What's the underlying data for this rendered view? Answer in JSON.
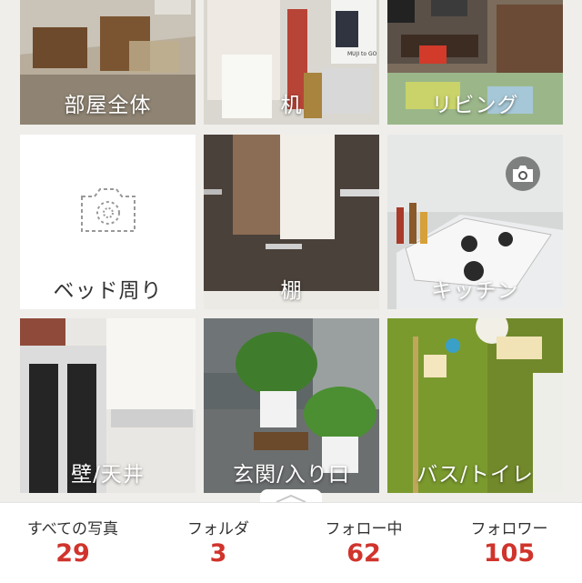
{
  "folders": [
    {
      "name": "部屋全体"
    },
    {
      "name": "机"
    },
    {
      "name": "リビング"
    },
    {
      "name": "ベッド周り"
    },
    {
      "name": "棚"
    },
    {
      "name": "キッチン"
    },
    {
      "name": "壁/天井"
    },
    {
      "name": "玄関/入り口"
    },
    {
      "name": "バス/トイレ"
    }
  ],
  "desk_photo": {
    "book_text": "MUJI to GO"
  },
  "stats": [
    {
      "label": "すべての写真",
      "count": "29"
    },
    {
      "label": "フォルダ",
      "count": "3"
    },
    {
      "label": "フォロー中",
      "count": "62"
    },
    {
      "label": "フォロワー",
      "count": "105"
    }
  ],
  "colors": {
    "accent": "#d0342c",
    "background": "#efeeeb",
    "bar": "#ffffff"
  },
  "icons": {
    "camera": "camera-icon",
    "dashed_camera": "add-photo-camera-icon",
    "expand": "chevron-up-icon"
  }
}
